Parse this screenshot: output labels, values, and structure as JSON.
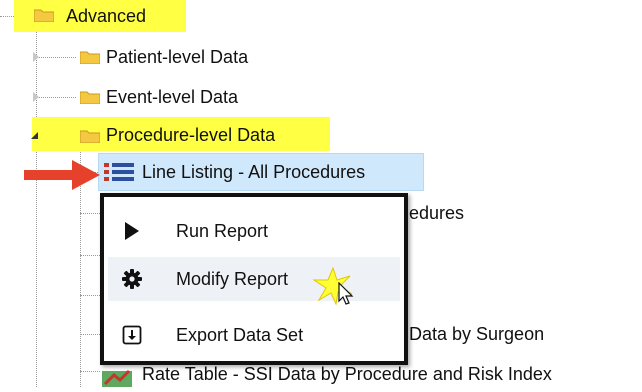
{
  "tree": {
    "advanced": {
      "label": "Advanced"
    },
    "patient_level": {
      "label": "Patient-level Data"
    },
    "event_level": {
      "label": "Event-level Data"
    },
    "procedure_level": {
      "label": "Procedure-level Data"
    },
    "line_listing": {
      "label": "Line Listing - All Procedures"
    },
    "partial_row_1": {
      "label": "edures"
    },
    "partial_row_2": {
      "label": "Data by Surgeon"
    },
    "rate_table_ssi": {
      "label": "Rate Table - SSI Data by Procedure and Risk Index"
    }
  },
  "context_menu": {
    "items": [
      {
        "label": "Run Report",
        "icon": "play-icon"
      },
      {
        "label": "Modify Report",
        "icon": "gear-icon"
      },
      {
        "label": "Export Data Set",
        "icon": "export-icon"
      }
    ]
  },
  "colors": {
    "highlight": "#ffff44",
    "selection": "#cfe8fb",
    "arrow": "#e5412b",
    "folder": "#f5c842",
    "menu_border": "#111111"
  }
}
